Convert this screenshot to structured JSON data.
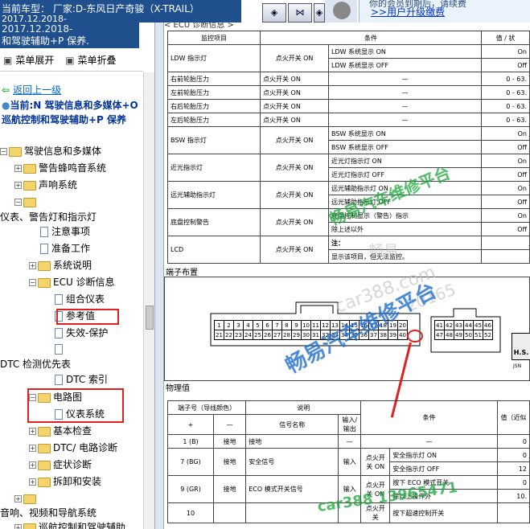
{
  "header": {
    "title": "当前车型： 厂家:D-东风日产奇骏（X-TRAIL）",
    "title2": "2017.12.2018-",
    "toolbar_buttons": [
      "◈",
      "⋈",
      "◈"
    ],
    "upgrade_top": "你的会员到期后，请续费",
    "upgrade_link": ">>用户升级缴费"
  },
  "left": {
    "panel_title": "和驾驶辅助+P 保养.",
    "expand_all": "菜单展开",
    "collapse_all": "菜单折叠",
    "back": "返回上一级",
    "current": "当前:N 驾驶信息和多媒体+O 巡航控制和驾驶辅助+P 保养",
    "tree": [
      "驾驶信息和多媒体",
      "警告蜂鸣音系统",
      "声响系统",
      "仪表、警告灯和指示灯",
      "注意事项",
      "准备工作",
      "系统说明",
      "ECU 诊断信息",
      "组合仪表",
      "参考值",
      "失效-保护",
      "DTC 检测优先表",
      "DTC 索引",
      "电路图",
      "仪表系统",
      "基本检查",
      "DTC/ 电路诊断",
      "症状诊断",
      "拆卸和安装",
      "音响、视频和导航系统",
      "巡航控制和驾驶辅助"
    ]
  },
  "doc": {
    "section_top": "< ECU 诊断信息 >",
    "table_headers": [
      "监控项目",
      "条件",
      "值 / 状"
    ],
    "rows": [
      {
        "item": "LDW 指示灯",
        "cond": "点火开关 ON",
        "sub": [
          "LDW 系统显示 ON",
          "LDW 系统显示 OFF"
        ],
        "val": [
          "On",
          "Off"
        ]
      },
      {
        "item": "右前轮胎压力",
        "cond": "点火开关 ON",
        "sub": [
          "—"
        ],
        "val": [
          "0 - 63."
        ]
      },
      {
        "item": "左前轮胎压力",
        "cond": "点火开关 ON",
        "sub": [
          "—"
        ],
        "val": [
          "0 - 63."
        ]
      },
      {
        "item": "右后轮胎压力",
        "cond": "点火开关 ON",
        "sub": [
          "—"
        ],
        "val": [
          "0 - 63."
        ]
      },
      {
        "item": "左后轮胎压力",
        "cond": "点火开关 ON",
        "sub": [
          "—"
        ],
        "val": [
          "0 - 63."
        ]
      },
      {
        "item": "BSW 指示灯",
        "cond": "点火开关 ON",
        "sub": [
          "BSW 系统显示 ON",
          "BSW 系统显示 OFF"
        ],
        "val": [
          "On",
          "Off"
        ]
      },
      {
        "item": "近光指示灯",
        "cond": "点火开关 ON",
        "sub": [
          "近光灯指示灯 ON",
          "近光灯指示灯 OFF"
        ],
        "val": [
          "On",
          "Off"
        ]
      },
      {
        "item": "远光辅助指示灯",
        "cond": "点火开关 ON",
        "sub": [
          "远光辅助指示灯 ON",
          "远光辅助指示灯 OFF"
        ],
        "val": [
          "On",
          "Off"
        ]
      },
      {
        "item": "底盘控制警告",
        "cond": "点火开关 ON",
        "sub": [
          "底盘控制显示（警告）指示",
          "除上述以外"
        ],
        "val": [
          "On",
          "Off"
        ]
      },
      {
        "item": "LCD",
        "cond": "点火开关 ON",
        "sub": [
          "注：",
          "显示该项目，但无法监控。"
        ],
        "val": [
          "",
          ""
        ]
      }
    ],
    "terminal_layout": "端子布置",
    "pins_row1": [
      "1",
      "2",
      "3",
      "4",
      "5",
      "6",
      "7",
      "8",
      "9",
      "10",
      "11",
      "12",
      "13",
      "14",
      "15",
      "16",
      "17",
      "18",
      "19",
      "20"
    ],
    "pins_row2": [
      "21",
      "22",
      "23",
      "24",
      "25",
      "26",
      "27",
      "28",
      "29",
      "30",
      "31",
      "32",
      "33",
      "34",
      "35",
      "36",
      "37",
      "38",
      "39",
      "40"
    ],
    "pins_right1": [
      "41",
      "42",
      "43",
      "44",
      "45",
      "46"
    ],
    "pins_right2": [
      "47",
      "48",
      "49",
      "50",
      "51",
      "52"
    ],
    "hs_label": "H.S.",
    "jsn_label": "JSN",
    "physical_values": "物理值",
    "pv_headers": {
      "terminal": "端子号（导线颜色）",
      "desc": "说明",
      "cond": "条件",
      "val": "值（近似"
    },
    "pv_sub": {
      "plus": "+",
      "minus": "—",
      "signal": "信号名称",
      "io": "输入/输出"
    },
    "pv_rows": [
      {
        "term": "1 (B)",
        "gnd": "接地",
        "sig": "接地",
        "io": "—",
        "cond": "",
        "sub": [
          "—"
        ],
        "val": [
          "0"
        ]
      },
      {
        "term": "7 (BG)",
        "gnd": "接地",
        "sig": "安全信号",
        "io": "输入",
        "cond": "点火开关 ON",
        "sub": [
          "安全指示灯 ON",
          "安全指示灯 OFF"
        ],
        "val": [
          "0",
          "12"
        ]
      },
      {
        "term": "9 (GR)",
        "gnd": "接地",
        "sig": "ECO 模式开关信号",
        "io": "输入",
        "cond": "点火开关 ON",
        "sub": [
          "按下 ECO 模式开关",
          "除以上操作外"
        ],
        "val": [
          "0",
          "10."
        ]
      },
      {
        "term": "10",
        "gnd": "",
        "sig": "",
        "io": "",
        "cond": "点火开关",
        "sub": [
          "按下超速控制开关"
        ],
        "val": [
          ""
        ]
      }
    ]
  },
  "watermarks": {
    "wm1": "畅易汽车维修平台",
    "wm2": "畅易汽车维修平台",
    "wm3": "畅易",
    "wm4": "car388.com",
    "wm5": "20165",
    "wm6": "car388 13965471"
  },
  "colors": {
    "title_bar": "#1f4f8c",
    "highlight": "#e02020",
    "link": "#0066cc"
  }
}
